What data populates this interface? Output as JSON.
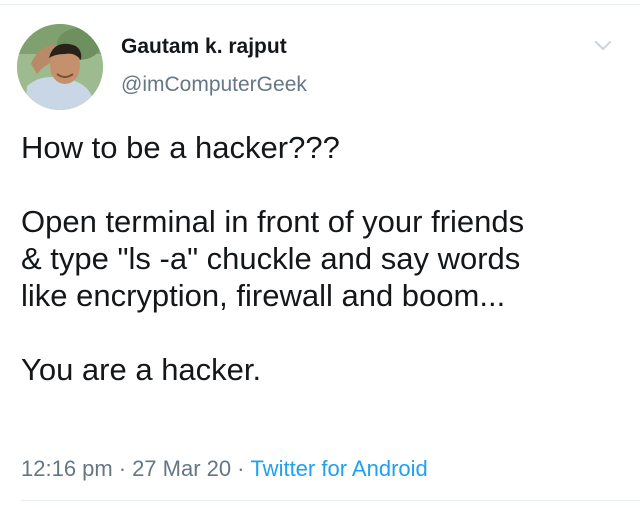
{
  "author": {
    "name": "Gautam k. rajput",
    "handle": "@imComputerGeek",
    "avatar_icon": "profile-photo"
  },
  "menu": {
    "icon": "chevron-down-icon",
    "color": "#ccd6dd"
  },
  "tweet": {
    "paragraphs": [
      "How to be a hacker???",
      "Open terminal in front of your friends\n& type \"ls -a\" chuckle and say words\nlike encryption, firewall and boom...",
      "You are a hacker."
    ]
  },
  "meta": {
    "time": "12:16 pm",
    "separator": "·",
    "date": "27 Mar 20",
    "source": "Twitter for Android",
    "source_color": "#1da1f2",
    "muted_color": "#657786"
  }
}
